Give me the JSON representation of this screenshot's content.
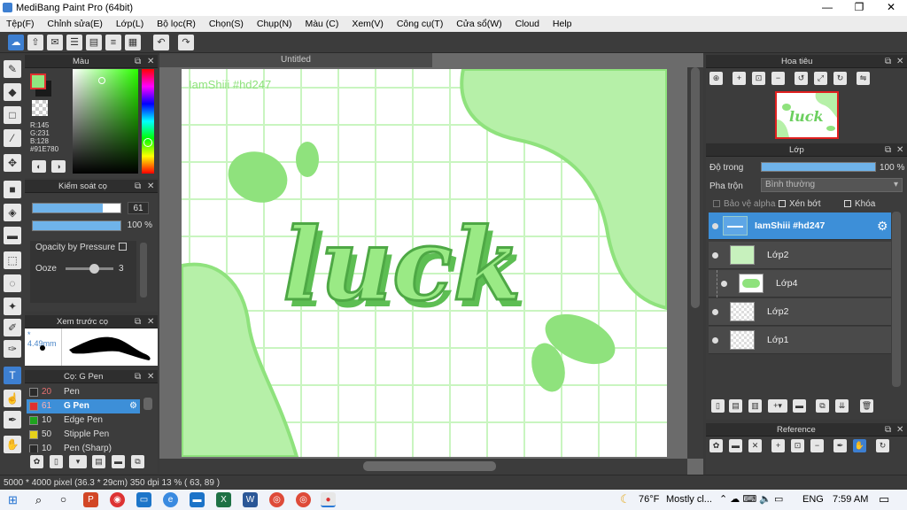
{
  "window": {
    "title": "MediBang Paint Pro (64bit)",
    "minimize": "—",
    "maximize": "❐",
    "close": "✕"
  },
  "menu": [
    "Tệp(F)",
    "Chỉnh sửa(E)",
    "Lớp(L)",
    "Bộ lọc(R)",
    "Chọn(S)",
    "Chụp(N)",
    "Màu (C)",
    "Xem(V)",
    "Công cụ(T)",
    "Cửa sổ(W)",
    "Cloud",
    "Help"
  ],
  "color_panel": {
    "title": "Màu",
    "r": "R:145",
    "g": "G:231",
    "b": "B:128",
    "hex": "#91E780",
    "primary_color": "#91e780"
  },
  "brush_control": {
    "title": "Kiểm soát cọ",
    "size_value": "61",
    "opacity_value": "100 %",
    "opacity_pressure_label": "Opacity by Pressure",
    "ooze_label": "Ooze",
    "ooze_value": "3"
  },
  "brush_preview": {
    "title": "Xem trước cọ",
    "size": "* 4.49mm"
  },
  "brush_list": {
    "title": "Cọ: G Pen",
    "items": [
      {
        "size": "20",
        "name": "Pen",
        "color": "#2a2a2a"
      },
      {
        "size": "61",
        "name": "G Pen",
        "color": "#e03030"
      },
      {
        "size": "10",
        "name": "Edge Pen",
        "color": "#1fa31f"
      },
      {
        "size": "50",
        "name": "Stipple Pen",
        "color": "#e6d21a"
      },
      {
        "size": "10",
        "name": "Pen (Sharp)",
        "color": "#2a2a2a"
      }
    ]
  },
  "canvas": {
    "tab_title": "Untitled",
    "watermark": "IamShiii #hd247",
    "artwork_text": "luck"
  },
  "navigator": {
    "title": "Hoa tiêu"
  },
  "layer_panel": {
    "title": "Lớp",
    "opacity_label": "Độ trong",
    "opacity_value": "100 %",
    "blend_label": "Pha trộn",
    "blend_value": "Bình thường",
    "protect_alpha": "Bảo vệ alpha",
    "clipping": "Xén bớt",
    "lock": "Khóa",
    "layers": [
      {
        "name": "IamShiii #hd247",
        "selected": true
      },
      {
        "name": "Lớp2",
        "selected": false
      },
      {
        "name": "Lớp4",
        "selected": false
      },
      {
        "name": "Lớp2",
        "selected": false
      },
      {
        "name": "Lớp1",
        "selected": false
      }
    ]
  },
  "reference_panel": {
    "title": "Reference"
  },
  "statusbar": {
    "info": "5000 * 4000 pixel  (36.3 * 29cm)  350 dpi  13 %  ( 63, 89 )"
  },
  "taskbar": {
    "weather_temp": "76°F",
    "weather_desc": "Mostly cl...",
    "lang": "ENG",
    "time": "7:59 AM"
  }
}
